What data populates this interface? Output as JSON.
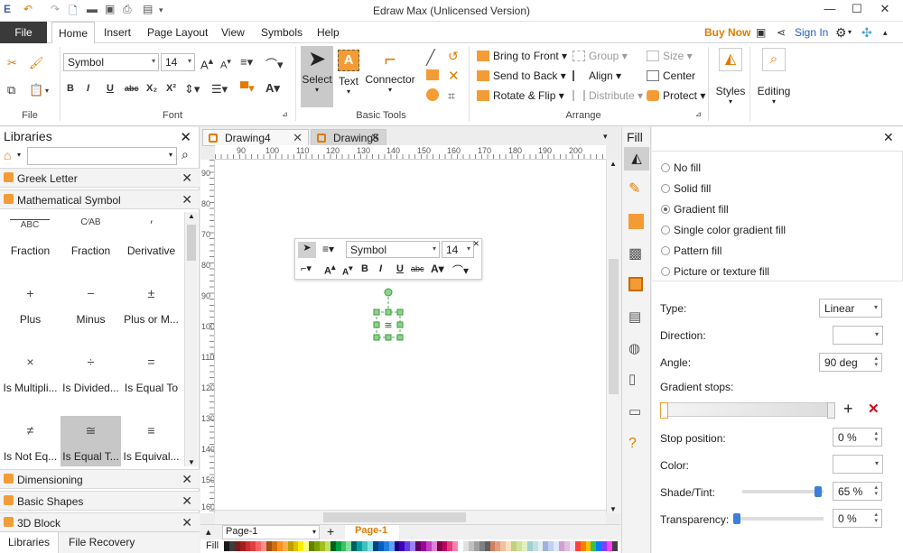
{
  "app": {
    "title": "Edraw Max (Unlicensed Version)"
  },
  "window": {
    "min": "—",
    "max": "☐",
    "close": "✕"
  },
  "menu": {
    "file": "File",
    "tabs": [
      "Home",
      "Insert",
      "Page Layout",
      "View",
      "Symbols",
      "Help"
    ],
    "buy_now": "Buy Now",
    "sign_in": "Sign In"
  },
  "ribbon": {
    "groups": {
      "file": "File",
      "font": "Font",
      "basic_tools": "Basic Tools",
      "arrange": "Arrange"
    },
    "font_name": "Symbol",
    "font_size": "14",
    "tools": {
      "select": "Select",
      "text": "Text",
      "connector": "Connector"
    },
    "arrange": {
      "bring_to_front": "Bring to Front",
      "send_to_back": "Send to Back",
      "rotate_flip": "Rotate & Flip",
      "group": "Group",
      "align": "Align",
      "distribute": "Distribute",
      "size": "Size",
      "center": "Center",
      "protect": "Protect"
    },
    "styles": "Styles",
    "editing": "Editing"
  },
  "libraries": {
    "title": "Libraries",
    "sections": {
      "greek": "Greek Letter",
      "math": "Mathematical Symbol",
      "dimensioning": "Dimensioning",
      "basic_shapes": "Basic Shapes",
      "block3d": "3D Block"
    },
    "shapes": [
      {
        "glyph": "ABC",
        "label": "Fraction"
      },
      {
        "glyph": "C⁄AB",
        "label": "Fraction"
      },
      {
        "glyph": "′",
        "label": "Derivative"
      },
      {
        "glyph": "+",
        "label": "Plus"
      },
      {
        "glyph": "−",
        "label": "Minus"
      },
      {
        "glyph": "±",
        "label": "Plus or M..."
      },
      {
        "glyph": "×",
        "label": "Is Multipli..."
      },
      {
        "glyph": "÷",
        "label": "Is Divided..."
      },
      {
        "glyph": "=",
        "label": "Is Equal To"
      },
      {
        "glyph": "≠",
        "label": "Is Not Eq..."
      },
      {
        "glyph": "≅",
        "label": "Is Equal T..."
      },
      {
        "glyph": "≡",
        "label": "Is Equival..."
      }
    ],
    "bottom_tabs": [
      "Libraries",
      "File Recovery"
    ]
  },
  "documents": {
    "tabs": [
      "Drawing4",
      "Drawing5"
    ]
  },
  "ruler": {
    "h": [
      "90",
      "100",
      "110",
      "120",
      "130",
      "140",
      "150",
      "160",
      "170",
      "180",
      "190",
      "200"
    ],
    "v": [
      "90",
      "80",
      "70",
      "80",
      "90",
      "100",
      "110",
      "120",
      "130",
      "140",
      "150",
      "160"
    ]
  },
  "floatbar": {
    "font": "Symbol",
    "size": "14"
  },
  "pages": {
    "tab": "Page-1",
    "active": "Page-1",
    "fill_label": "Fill"
  },
  "fill": {
    "title": "Fill",
    "options": [
      "No fill",
      "Solid fill",
      "Gradient fill",
      "Single color gradient fill",
      "Pattern fill",
      "Picture or texture fill"
    ],
    "selected": "Gradient fill",
    "type_label": "Type:",
    "type_value": "Linear",
    "direction_label": "Direction:",
    "angle_label": "Angle:",
    "angle_value": "90 deg",
    "stops_label": "Gradient stops:",
    "stop_position_label": "Stop position:",
    "stop_position_value": "0 %",
    "color_label": "Color:",
    "shade_label": "Shade/Tint:",
    "shade_value": "65 %",
    "transparency_label": "Transparency:",
    "transparency_value": "0 %",
    "accent": "#f39c36",
    "remove_color": "#d0021b"
  },
  "palette": [
    "#1a1a1a",
    "#3c3c3c",
    "#7a1a1a",
    "#a02020",
    "#c83030",
    "#e04040",
    "#ff6060",
    "#ff9090",
    "#a05010",
    "#d07010",
    "#ff9020",
    "#ffb050",
    "#c0a000",
    "#e0c000",
    "#fff000",
    "#ffff80",
    "#608000",
    "#80a000",
    "#a0c020",
    "#c0e060",
    "#006020",
    "#00a040",
    "#40c060",
    "#80e0a0",
    "#006060",
    "#00a0a0",
    "#40c0c0",
    "#80e0e0",
    "#004080",
    "#0060c0",
    "#2080e0",
    "#60a0ff",
    "#200080",
    "#4000c0",
    "#6040e0",
    "#a080ff",
    "#600060",
    "#a000a0",
    "#c040c0",
    "#e080e0",
    "#800040",
    "#c00060",
    "#e04080",
    "#ff80b0",
    "#ffffff",
    "#e0e0e0",
    "#c0c0c0",
    "#a0a0a0",
    "#808080",
    "#606060",
    "#d08060",
    "#e0a080",
    "#f0c0a0",
    "#f8e0c0",
    "#c0d080",
    "#d0e0a0",
    "#e0f0c0",
    "#a0d0d0",
    "#c0e0e0",
    "#e0f0f0",
    "#a0b0e0",
    "#c0d0f0",
    "#e0e8ff",
    "#d0a0d0",
    "#e0c0e0",
    "#f0e0f0",
    "#ff4040",
    "#ff8000",
    "#ffc000",
    "#40c040",
    "#0080ff",
    "#8040ff",
    "#ff40ff",
    "#404040"
  ]
}
